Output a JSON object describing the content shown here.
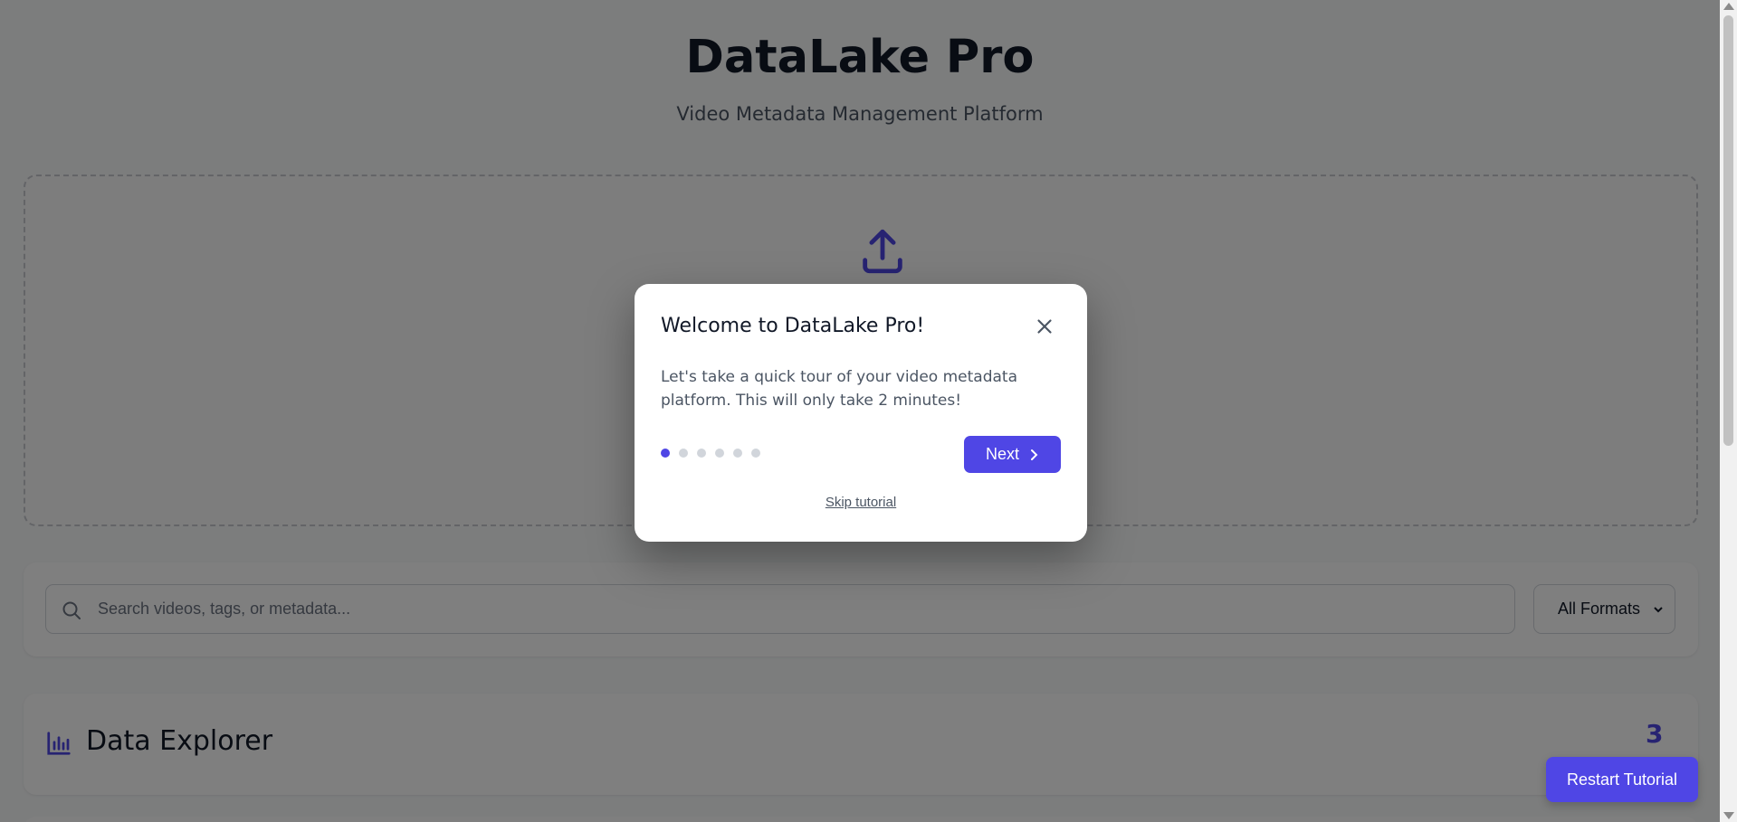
{
  "app": {
    "title": "DataLake Pro",
    "subtitle": "Video Metadata Management Platform"
  },
  "upload": {
    "icon": "upload-icon"
  },
  "search": {
    "placeholder": "Search videos, tags, or metadata...",
    "value": "",
    "format_selected": "All Formats"
  },
  "explorer": {
    "title": "Data Explorer",
    "count": "3",
    "icon": "bar-chart-icon"
  },
  "restart_tutorial_label": "Restart Tutorial",
  "modal": {
    "title": "Welcome to DataLake Pro!",
    "body": "Let's take a quick tour of your video metadata platform. This will only take 2 minutes!",
    "next_label": "Next",
    "skip_label": "Skip tutorial",
    "step": 1,
    "total_steps": 6
  },
  "colors": {
    "accent": "#4f46e5",
    "overlay": "rgba(0,0,0,0.5)"
  }
}
